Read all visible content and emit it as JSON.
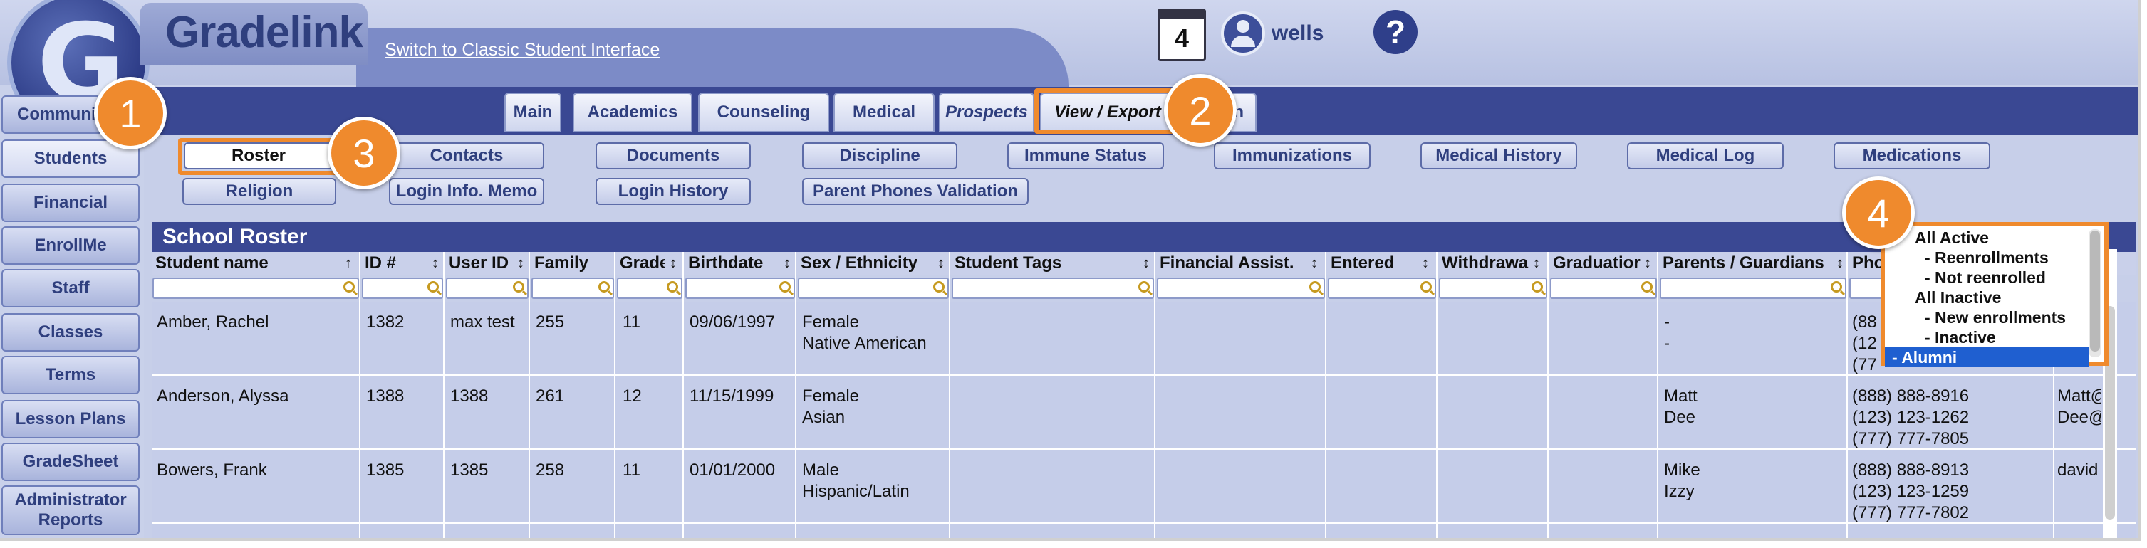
{
  "header": {
    "brand": "Gradelink",
    "switch_link": "Switch to Classic Student Interface",
    "calendar_day": "4",
    "username": "wells",
    "help": "?"
  },
  "leftnav": [
    "Communication",
    "Students",
    "Financial",
    "EnrollMe",
    "Staff",
    "Classes",
    "Terms",
    "Lesson Plans",
    "GradeSheet",
    "Administrator Reports"
  ],
  "leftnav_visible": [
    "Communic",
    "Students",
    "Financial",
    "EnrollMe",
    "Staff",
    "Classes",
    "Terms",
    "Lesson Plans",
    "GradeSheet",
    "Administrator Reports"
  ],
  "tabs": [
    "Main",
    "Academics",
    "Counseling",
    "Medical",
    "Prospects",
    "View / Export",
    "n"
  ],
  "subtabs_row1": [
    "Roster",
    "Contacts",
    "Documents",
    "Discipline",
    "Immune Status",
    "Immunizations",
    "Medical History",
    "Medical Log",
    "Medications"
  ],
  "subtabs_row2": [
    "Religion",
    "Login Info. Memo",
    "Login History",
    "Parent Phones Validation"
  ],
  "roster": {
    "title": "School Roster",
    "columns": [
      "Student name",
      "ID #",
      "User ID",
      "Family",
      "Grade",
      "Birthdate",
      "Sex / Ethnicity",
      "Student Tags",
      "Financial Assist.",
      "Entered",
      "Withdrawa",
      "Graduatior",
      "Parents / Guardians",
      "Pho",
      ""
    ],
    "rows": [
      {
        "name": "Amber, Rachel",
        "id": "1382",
        "user": "max test",
        "family": "255",
        "grade": "11",
        "birth": "09/06/1997",
        "sex": "Female",
        "eth": "Native American",
        "p1": "-",
        "p2": "-",
        "ph1": "(88",
        "ph2": "(12",
        "ph3": "(77",
        "email1": "",
        "email2": ""
      },
      {
        "name": "Anderson, Alyssa",
        "id": "1388",
        "user": "1388",
        "family": "261",
        "grade": "12",
        "birth": "11/15/1999",
        "sex": "Female",
        "eth": "Asian",
        "p1": "Matt",
        "p2": "Dee",
        "ph1": "(888) 888-8916",
        "ph2": "(123) 123-1262",
        "ph3": "(777) 777-7805",
        "email1": "Matt@",
        "email2": "Dee@"
      },
      {
        "name": "Bowers, Frank",
        "id": "1385",
        "user": "1385",
        "family": "258",
        "grade": "11",
        "birth": "01/01/2000",
        "sex": "Male",
        "eth": "Hispanic/Latin",
        "p1": "Mike",
        "p2": "Izzy",
        "ph1": "(888) 888-8913",
        "ph2": "(123) 123-1259",
        "ph3": "(777) 777-7802",
        "email1": "david",
        "email2": ""
      }
    ]
  },
  "dropdown": [
    "All Active",
    "- Reenrollments",
    "- Not reenrolled",
    "All Inactive",
    "- New enrollments",
    "- Inactive",
    "- Alumni"
  ],
  "callouts": [
    "1",
    "2",
    "3",
    "4"
  ],
  "colors": {
    "accent": "#ef8a2d",
    "navy": "#3a4893",
    "selected": "#1f5fd0"
  }
}
